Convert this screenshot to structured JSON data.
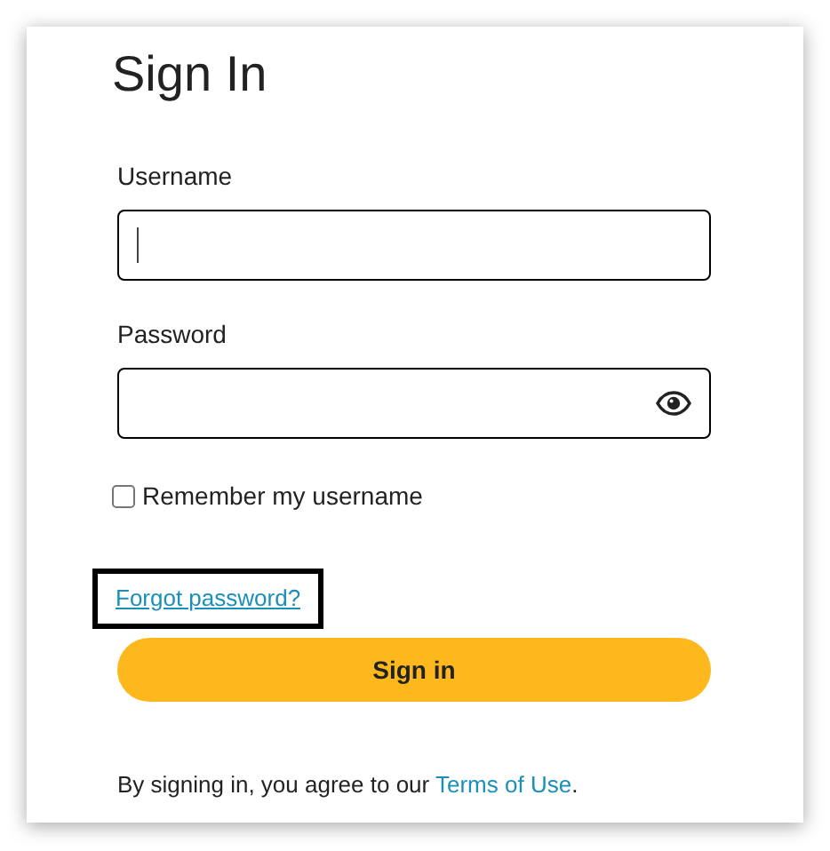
{
  "title": "Sign In",
  "fields": [
    {
      "label": "Username",
      "kind": "text",
      "focused": true
    },
    {
      "label": "Password",
      "kind": "password",
      "focused": false
    }
  ],
  "remember": {
    "label": "Remember my username",
    "checked": false
  },
  "forgot_link": {
    "label": "Forgot password?",
    "focused": true
  },
  "submit": {
    "label": "Sign in"
  },
  "terms": {
    "prefix": "By signing in, you agree to our ",
    "link": "Terms of Use",
    "suffix": "."
  }
}
